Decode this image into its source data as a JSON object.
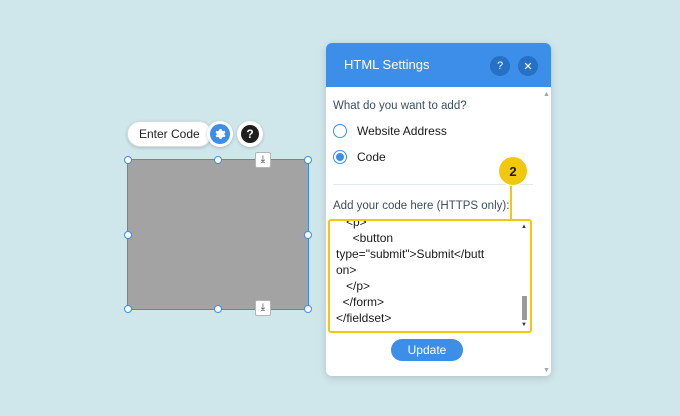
{
  "toolbar": {
    "enter_code_label": "Enter Code",
    "settings_icon": "gear-icon",
    "help_icon": "question-icon",
    "help_glyph": "?"
  },
  "panel": {
    "title": "HTML Settings",
    "help_label": "?",
    "close_label": "✕",
    "question": "What do you want to add?",
    "options": [
      {
        "label": "Website Address",
        "checked": false
      },
      {
        "label": "Code",
        "checked": true
      }
    ],
    "code_label": "Add your code here (HTTPS only):",
    "code_lines": [
      "   <p>",
      "     <button",
      "type=\"submit\">Submit</butt",
      "on>",
      "   </p>",
      "  </form>",
      "</fieldset>"
    ],
    "update_label": "Update",
    "callout_number": "2"
  },
  "colors": {
    "accent": "#3d8ee8",
    "highlight": "#f2c80f",
    "background": "#cfe6ea",
    "placeholder": "#a3a3a3"
  }
}
